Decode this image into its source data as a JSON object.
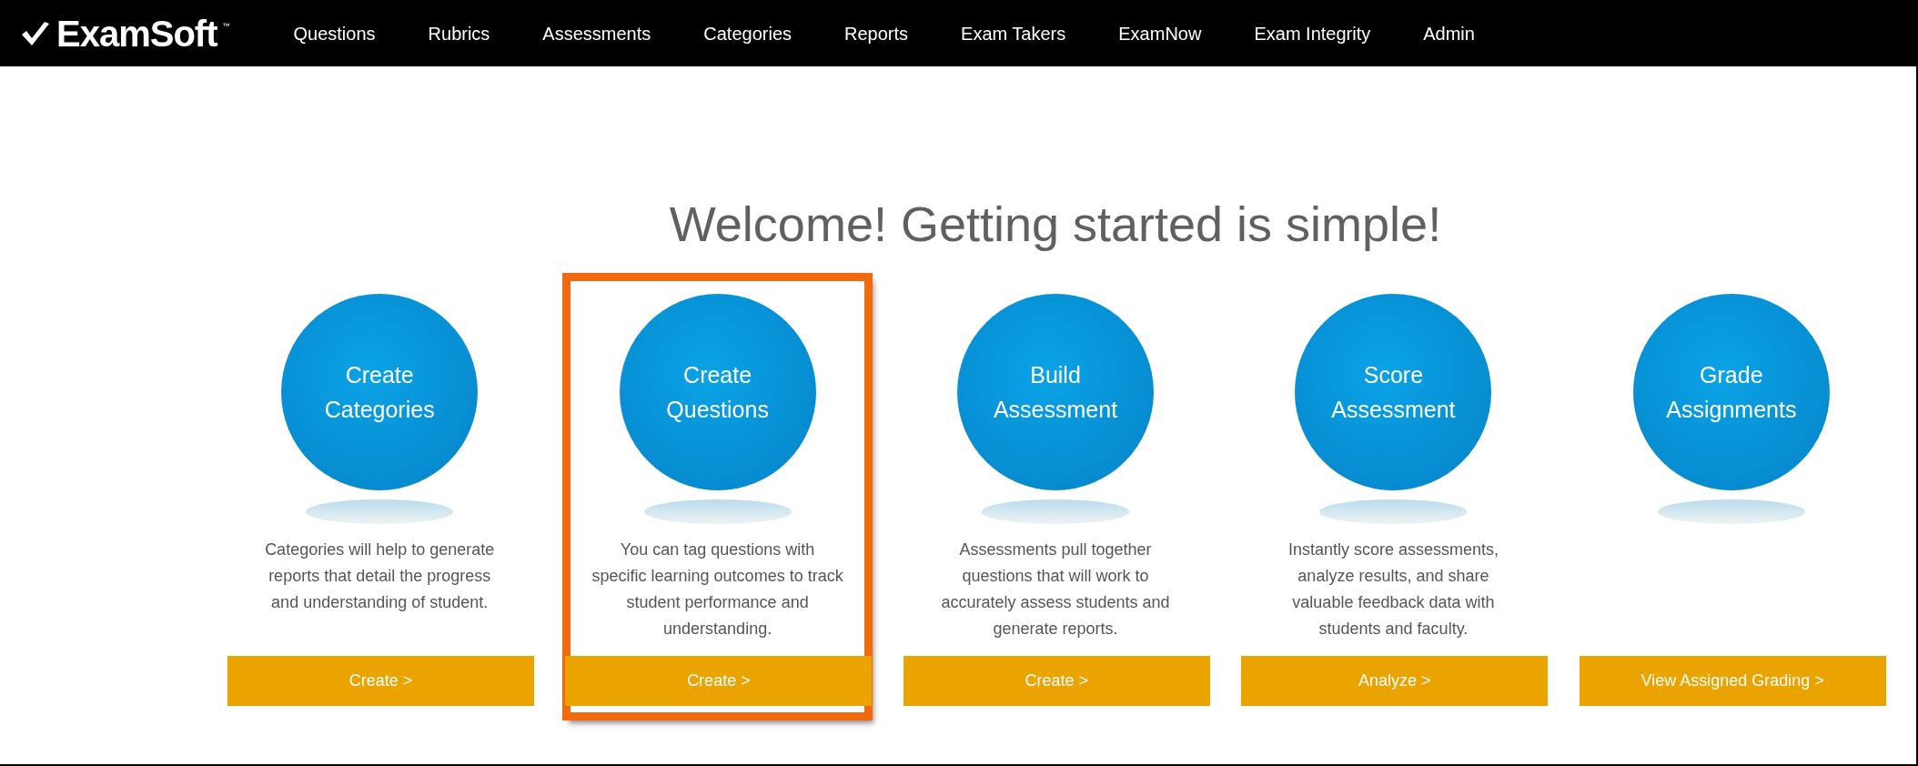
{
  "logo": {
    "text": "ExamSoft",
    "trademark": "™"
  },
  "nav": [
    {
      "label": "Questions"
    },
    {
      "label": "Rubrics"
    },
    {
      "label": "Assessments"
    },
    {
      "label": "Categories"
    },
    {
      "label": "Reports"
    },
    {
      "label": "Exam Takers"
    },
    {
      "label": "ExamNow"
    },
    {
      "label": "Exam Integrity"
    },
    {
      "label": "Admin"
    }
  ],
  "heading": "Welcome! Getting started is simple!",
  "cards": [
    {
      "title": [
        "Create",
        "Categories"
      ],
      "description": "Categories will help to generate reports that detail the progress and understanding of student.",
      "button": "Create >",
      "highlighted": false
    },
    {
      "title": [
        "Create",
        "Questions"
      ],
      "description": "You can tag questions with specific learning outcomes to track student performance and understanding.",
      "button": "Create >",
      "highlighted": true
    },
    {
      "title": [
        "Build",
        "Assessment"
      ],
      "description": "Assessments pull together questions that will work to accurately assess students and generate reports.",
      "button": "Create >",
      "highlighted": false
    },
    {
      "title": [
        "Score",
        "Assessment"
      ],
      "description": "Instantly score assessments, analyze results, and share valuable feedback data with students and faculty.",
      "button": "Analyze >",
      "highlighted": false
    },
    {
      "title": [
        "Grade",
        "Assignments"
      ],
      "button": "View Assigned Grading >",
      "highlighted": false
    }
  ]
}
